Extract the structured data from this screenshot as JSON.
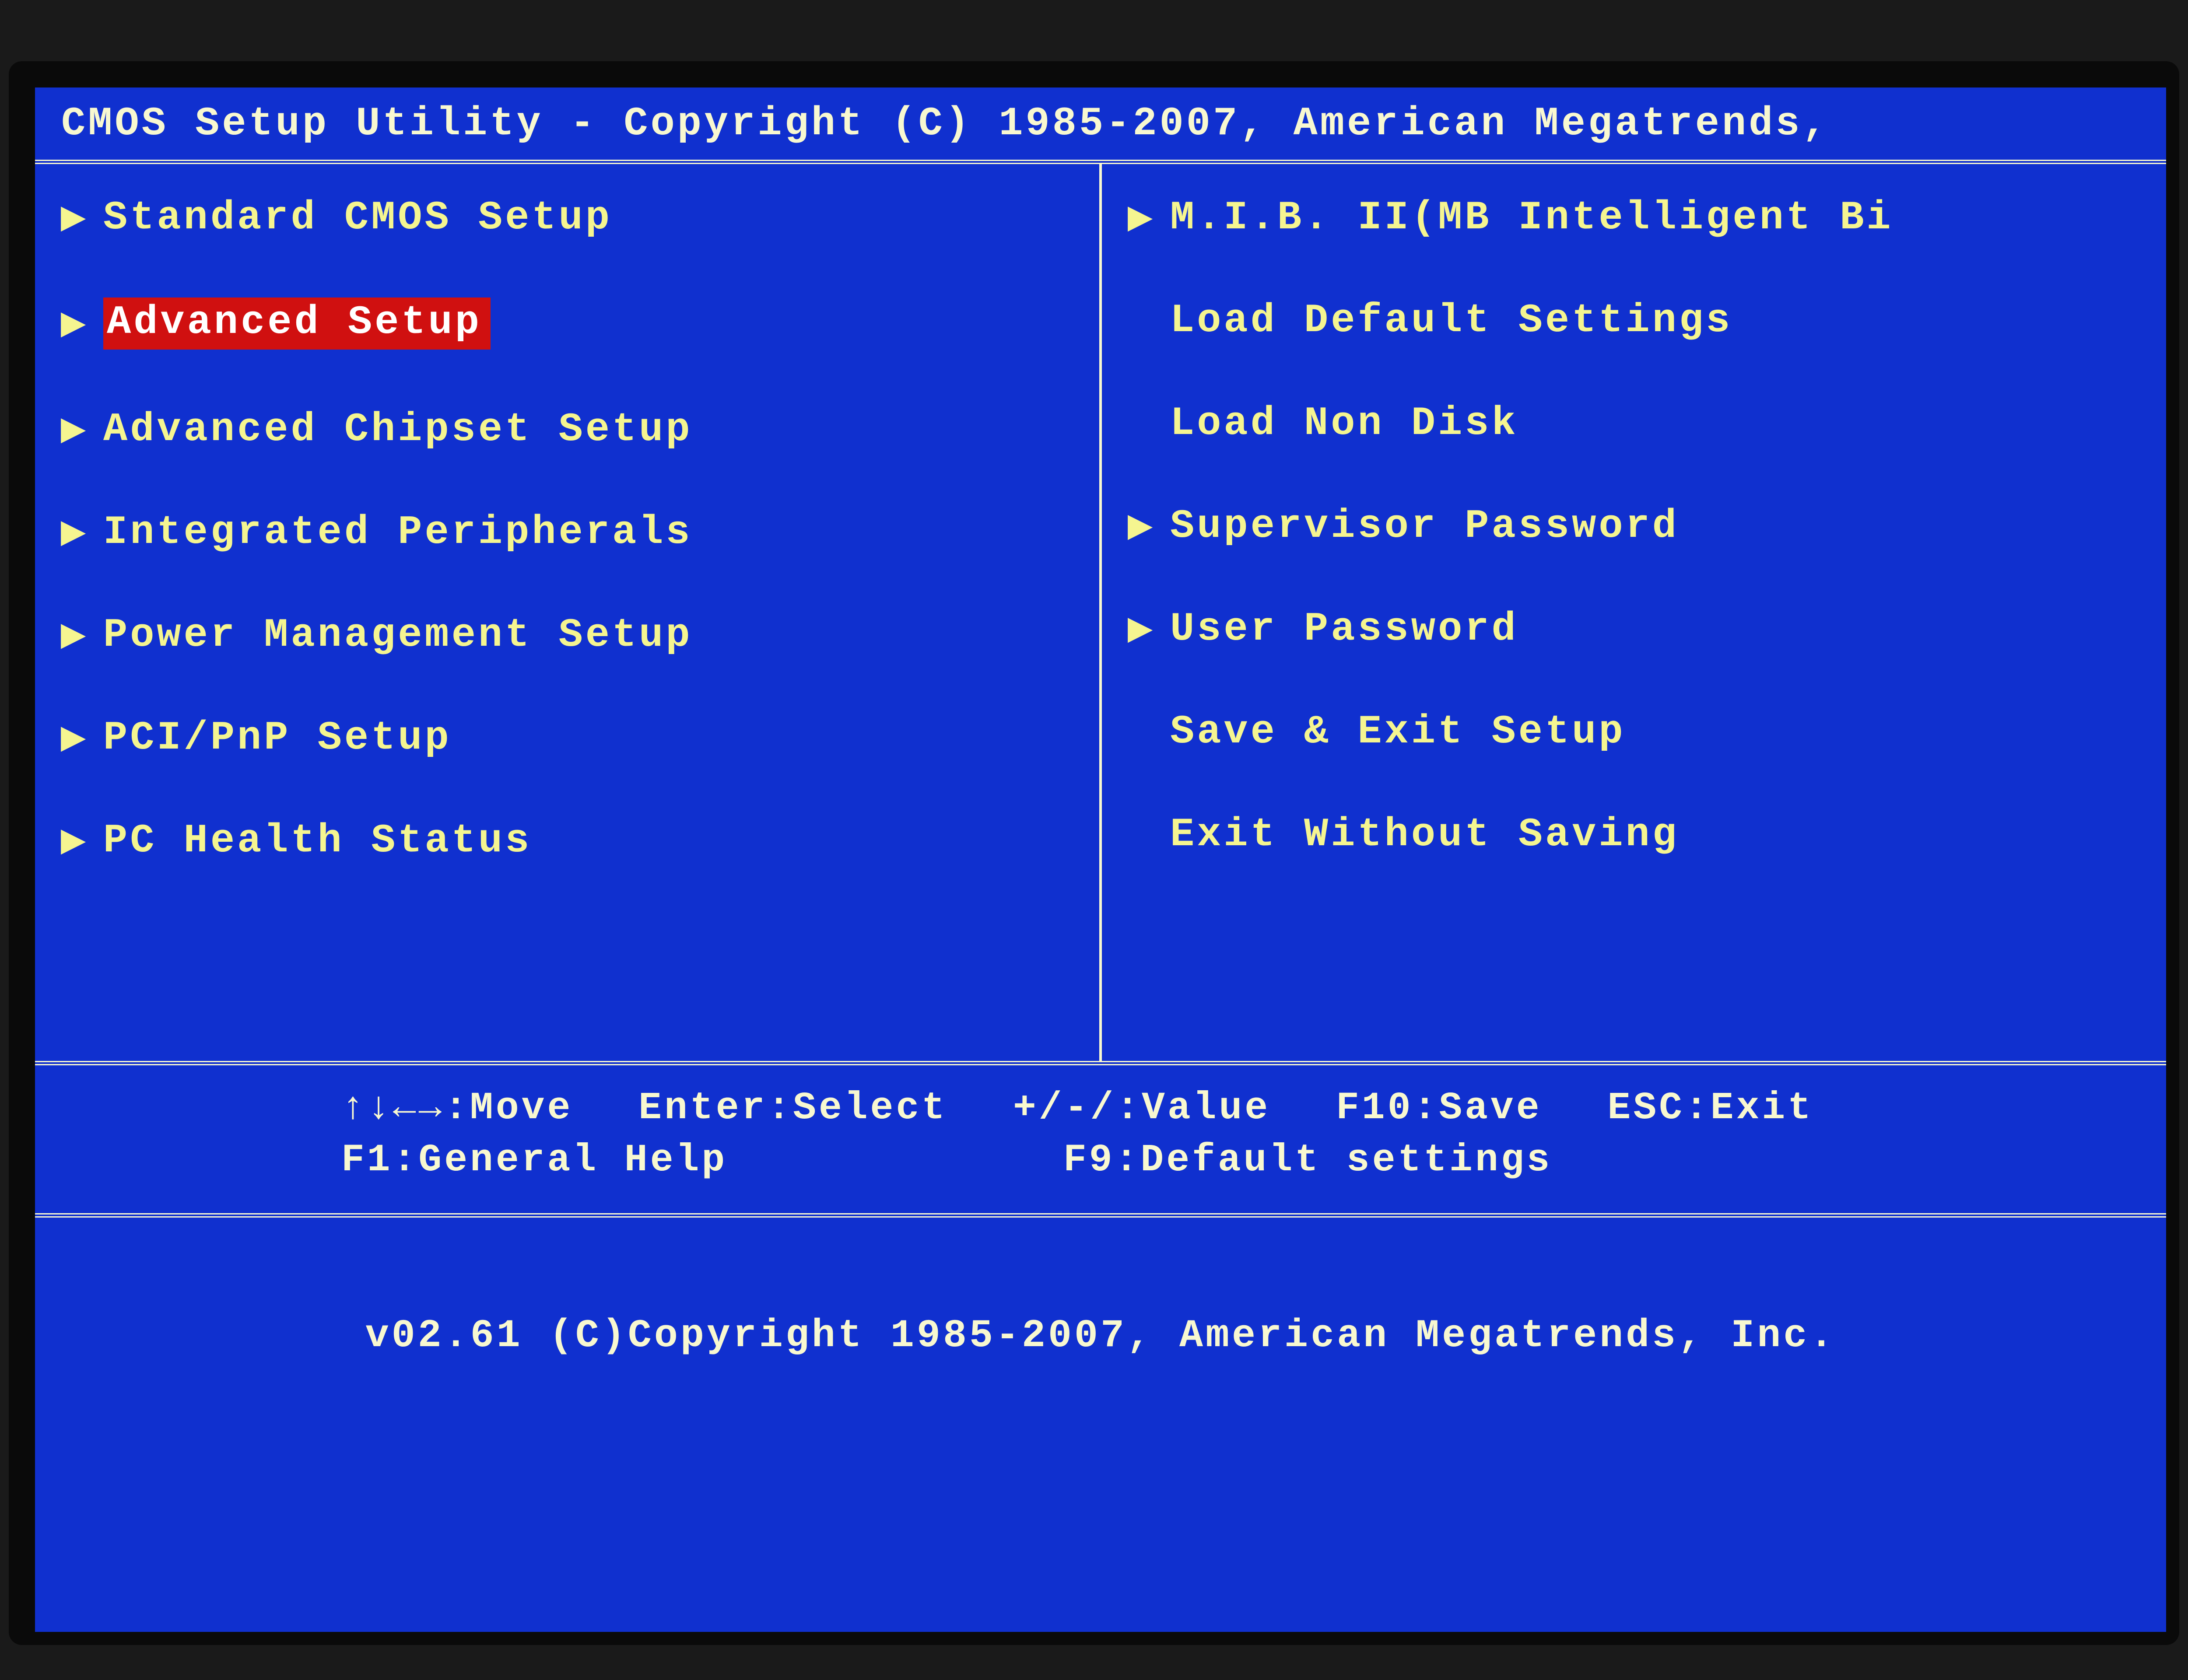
{
  "title": "CMOS Setup Utility - Copyright (C) 1985-2007, American Megatrends,",
  "menu_left": [
    {
      "label": "Standard CMOS Setup",
      "tri": true,
      "selected": false
    },
    {
      "label": "Advanced Setup",
      "tri": true,
      "selected": true
    },
    {
      "label": "Advanced Chipset Setup",
      "tri": true,
      "selected": false
    },
    {
      "label": "Integrated Peripherals",
      "tri": true,
      "selected": false
    },
    {
      "label": "Power Management Setup",
      "tri": true,
      "selected": false
    },
    {
      "label": "PCI/PnP Setup",
      "tri": true,
      "selected": false
    },
    {
      "label": "PC Health Status",
      "tri": true,
      "selected": false
    }
  ],
  "menu_right": [
    {
      "label": "M.I.B. II(MB Intelligent Bi",
      "tri": true,
      "selected": false
    },
    {
      "label": "Load Default Settings",
      "tri": false,
      "selected": false
    },
    {
      "label": "Load Non Disk",
      "tri": false,
      "selected": false
    },
    {
      "label": "Supervisor Password",
      "tri": true,
      "selected": false
    },
    {
      "label": "User Password",
      "tri": true,
      "selected": false
    },
    {
      "label": "Save & Exit Setup",
      "tri": false,
      "selected": false
    },
    {
      "label": "Exit Without Saving",
      "tri": false,
      "selected": false
    }
  ],
  "help": {
    "r1c1": "↑↓←→:Move",
    "r1c2": "Enter:Select",
    "r1c3": "+/-/:Value",
    "r1c4": "F10:Save",
    "r1c5": "ESC:Exit",
    "r2c1": "F1:General Help",
    "r2c3": "F9:Default settings"
  },
  "footer": "v02.61 (C)Copyright 1985-2007, American Megatrends, Inc."
}
